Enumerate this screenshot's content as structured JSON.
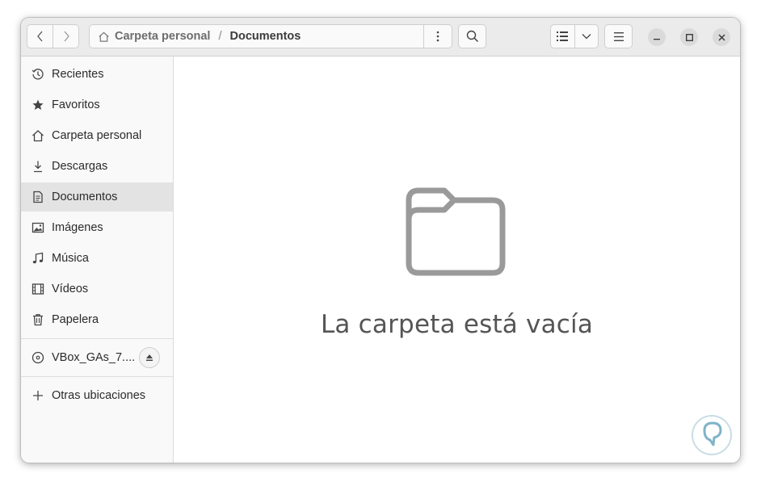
{
  "path": {
    "home": "Carpeta personal",
    "separator": "/",
    "current": "Documentos"
  },
  "sidebar": {
    "items": [
      {
        "label": "Recientes",
        "icon": "clock-icon"
      },
      {
        "label": "Favoritos",
        "icon": "star-icon"
      },
      {
        "label": "Carpeta personal",
        "icon": "home-icon"
      },
      {
        "label": "Descargas",
        "icon": "download-icon"
      },
      {
        "label": "Documentos",
        "icon": "document-icon",
        "active": true
      },
      {
        "label": "Imágenes",
        "icon": "image-icon"
      },
      {
        "label": "Música",
        "icon": "music-icon"
      },
      {
        "label": "Vídeos",
        "icon": "video-icon"
      },
      {
        "label": "Papelera",
        "icon": "trash-icon"
      }
    ],
    "device": {
      "label": "VBox_GAs_7....",
      "icon": "disc-icon"
    },
    "other": {
      "label": "Otras ubicaciones",
      "icon": "plus-icon"
    }
  },
  "main": {
    "empty_message": "La carpeta está vacía",
    "icon": "folder-icon"
  },
  "colors": {
    "headerbar": "#ebebeb",
    "sidebar": "#f9f9f9",
    "active_item": "#e3e3e3",
    "icon_gray": "#9a9a9a"
  }
}
